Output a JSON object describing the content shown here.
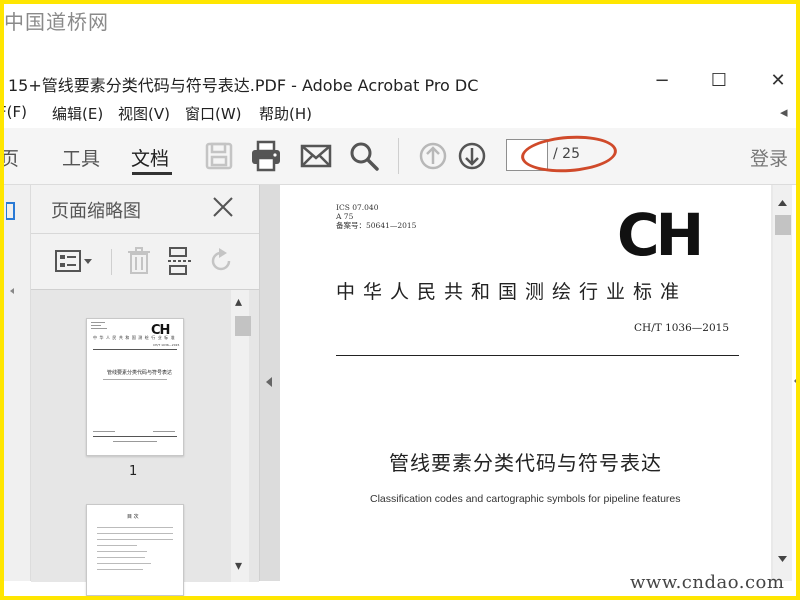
{
  "watermark": {
    "top": "中国道桥网",
    "bottom": "www.cndao.com"
  },
  "window": {
    "title": "15+管线要素分类代码与符号表达.PDF - Adobe Acrobat Pro DC",
    "minimize": "−",
    "maximize": "☐",
    "close": "✕"
  },
  "menu": {
    "items": [
      {
        "label": "F(F)"
      },
      {
        "label": "编辑(E)"
      },
      {
        "label": "视图(V)"
      },
      {
        "label": "窗口(W)"
      },
      {
        "label": "帮助(H)"
      }
    ],
    "overflow": "◂"
  },
  "toolbar": {
    "tabs": [
      {
        "label": "页"
      },
      {
        "label": "工具"
      },
      {
        "label": "文档"
      }
    ],
    "active_tab": "文档",
    "page_current": "",
    "page_total": "/ 25",
    "login": "登录",
    "accent_annotation_color": "#d04a2a"
  },
  "thumbnails": {
    "title": "页面缩略图",
    "page1_number": "1",
    "page1": {
      "org": "中 华 人 民 共 和 国 测 绘 行 业 标 准",
      "code": "CH/T 1036—2015",
      "title_cn": "管线要素分类代码与符号表达",
      "logo": "CH"
    },
    "page2": {
      "heading": "目  次"
    },
    "scroll_up": "▴",
    "scroll_down": "▾"
  },
  "document": {
    "ics_lines": [
      "ICS  07.040",
      "A  75",
      "备案号：50641—2015"
    ],
    "logo": "CH",
    "org": "中华人民共和国测绘行业标准",
    "code": "CH/T  1036—2015",
    "title_cn": "管线要素分类代码与符号表达",
    "title_en": "Classification codes and cartographic symbols for pipeline features"
  },
  "colors": {
    "frame_border": "#ffe600",
    "toolbar_bg": "#f5f5f5",
    "panel_bg": "#f2f2f2"
  }
}
